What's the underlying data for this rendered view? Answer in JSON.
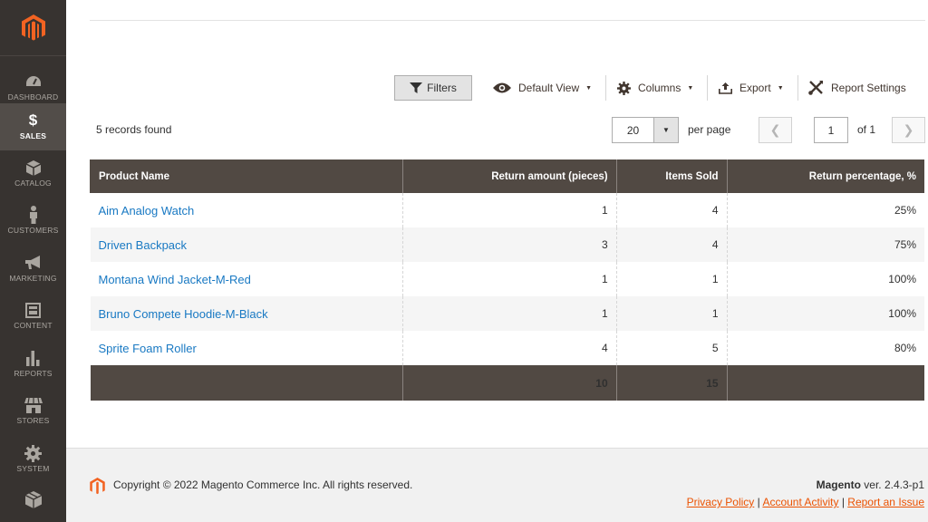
{
  "sidebar": {
    "items": [
      {
        "label": "DASHBOARD",
        "icon": "dashboard-icon"
      },
      {
        "label": "SALES",
        "icon": "dollar-icon",
        "active": true
      },
      {
        "label": "CATALOG",
        "icon": "box-icon"
      },
      {
        "label": "CUSTOMERS",
        "icon": "person-icon"
      },
      {
        "label": "MARKETING",
        "icon": "megaphone-icon"
      },
      {
        "label": "CONTENT",
        "icon": "layout-icon"
      },
      {
        "label": "REPORTS",
        "icon": "bar-chart-icon"
      },
      {
        "label": "STORES",
        "icon": "store-icon"
      },
      {
        "label": "SYSTEM",
        "icon": "gear-icon"
      }
    ]
  },
  "toolbar": {
    "filters_label": "Filters",
    "default_view_label": "Default View",
    "columns_label": "Columns",
    "export_label": "Export",
    "report_settings_label": "Report Settings"
  },
  "records": {
    "found_text": "5 records found",
    "per_page_value": "20",
    "per_page_label": "per page",
    "current_page": "1",
    "of_text": "of 1"
  },
  "grid": {
    "headers": [
      "Product Name",
      "Return amount (pieces)",
      "Items Sold",
      "Return percentage, %"
    ],
    "rows": [
      {
        "name": "Aim Analog Watch",
        "returns": "1",
        "sold": "4",
        "pct": "25%"
      },
      {
        "name": "Driven Backpack",
        "returns": "3",
        "sold": "4",
        "pct": "75%"
      },
      {
        "name": "Montana Wind Jacket-M-Red",
        "returns": "1",
        "sold": "1",
        "pct": "100%"
      },
      {
        "name": "Bruno Compete Hoodie-M-Black",
        "returns": "1",
        "sold": "1",
        "pct": "100%"
      },
      {
        "name": "Sprite Foam Roller",
        "returns": "4",
        "sold": "5",
        "pct": "80%"
      }
    ],
    "totals": {
      "returns": "10",
      "sold": "15"
    }
  },
  "footer": {
    "copyright": "Copyright © 2022 Magento Commerce Inc. All rights reserved.",
    "brand": "Magento",
    "version": " ver. 2.4.3-p1",
    "links": [
      "Privacy Policy",
      "Account Activity",
      "Report an Issue"
    ]
  },
  "colors": {
    "sidebar_bg": "#373330",
    "sidebar_active": "#524d49",
    "header_bg": "#514943",
    "link": "#1979c3",
    "brand_orange": "#eb5202"
  }
}
